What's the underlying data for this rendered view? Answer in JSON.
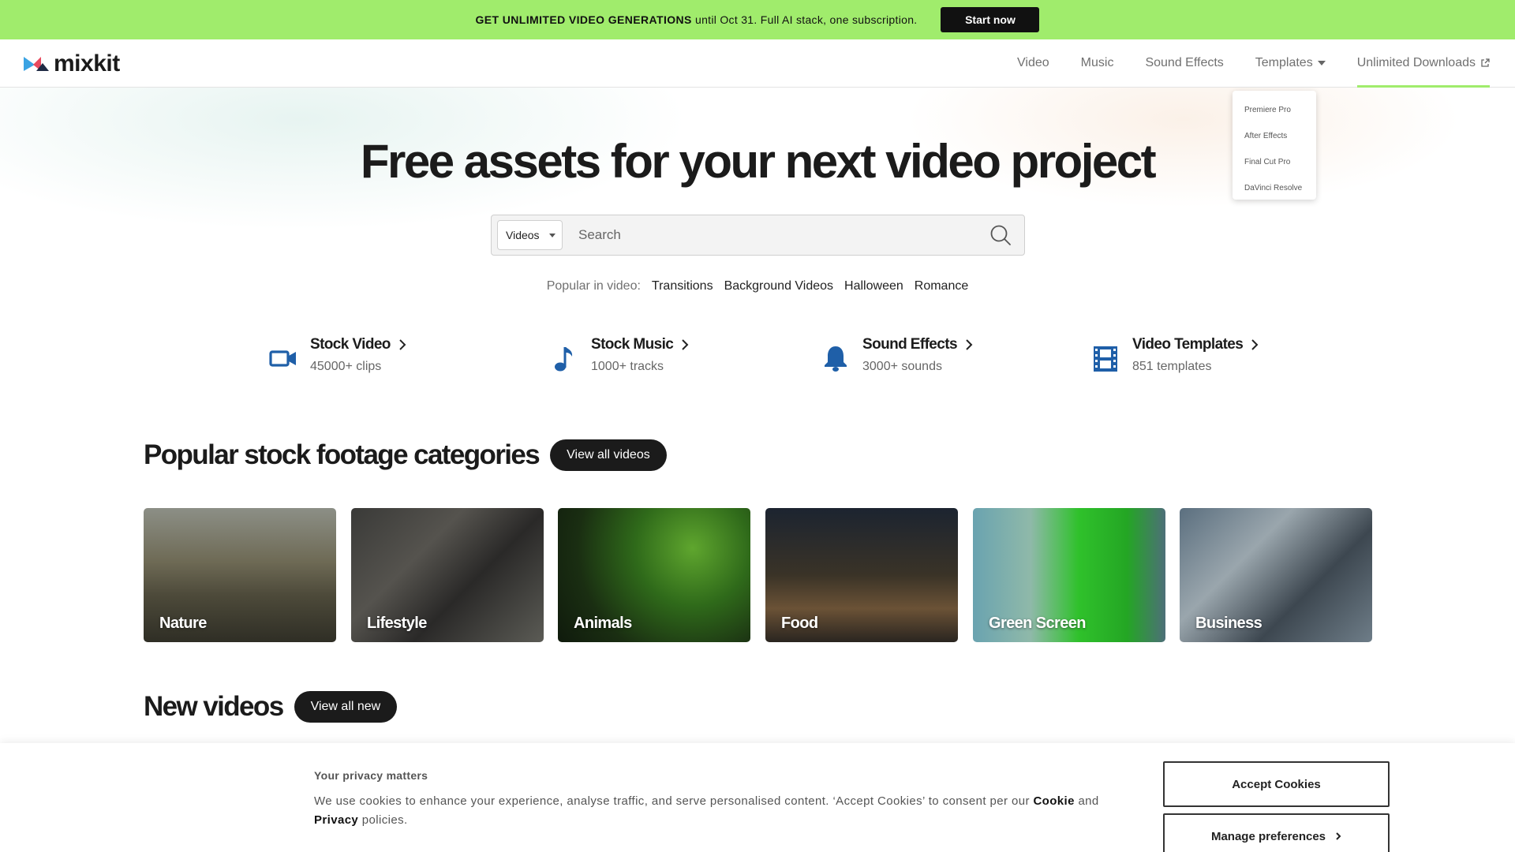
{
  "promo": {
    "headline": "GET UNLIMITED VIDEO GENERATIONS",
    "tail": "until Oct 31. Full AI stack, one subscription.",
    "button": "Start now"
  },
  "header": {
    "logo": "mixkit",
    "nav": [
      "Video",
      "Music",
      "Sound Effects",
      "Templates",
      "Unlimited Downloads"
    ],
    "templates_menu": [
      "Premiere Pro",
      "After Effects",
      "Final Cut Pro",
      "DaVinci Resolve"
    ]
  },
  "hero": {
    "title": "Free assets for your next video project",
    "search_type": "Videos",
    "search_placeholder": "Search",
    "popular_label": "Popular in video:",
    "popular": [
      "Transitions",
      "Background Videos",
      "Halloween",
      "Romance"
    ]
  },
  "asset_types": [
    {
      "title": "Stock Video",
      "sub": "45000+ clips",
      "icon": "video-camera-icon"
    },
    {
      "title": "Stock Music",
      "sub": "1000+ tracks",
      "icon": "music-note-icon"
    },
    {
      "title": "Sound Effects",
      "sub": "3000+ sounds",
      "icon": "bell-icon"
    },
    {
      "title": "Video Templates",
      "sub": "851 templates",
      "icon": "film-strip-icon"
    }
  ],
  "categories_section": {
    "title": "Popular stock footage categories",
    "button": "View all videos",
    "cards": [
      "Nature",
      "Lifestyle",
      "Animals",
      "Food",
      "Green Screen",
      "Business"
    ]
  },
  "new_section": {
    "title": "New videos",
    "button": "View all new"
  },
  "cookie": {
    "title": "Your privacy matters",
    "text_1": "We use cookies to enhance your experience, analyse traffic, and serve personalised content. ‘Accept Cookies’ to consent per our",
    "cookie_link": "Cookie",
    "and": "and",
    "privacy_link": "Privacy",
    "text_2": "policies.",
    "accept": "Accept Cookies",
    "manage": "Manage preferences"
  },
  "colors": {
    "promo_bg": "#a0ec6c",
    "accent_blue": "#1f5fa8",
    "dark": "#1b1b1b"
  }
}
